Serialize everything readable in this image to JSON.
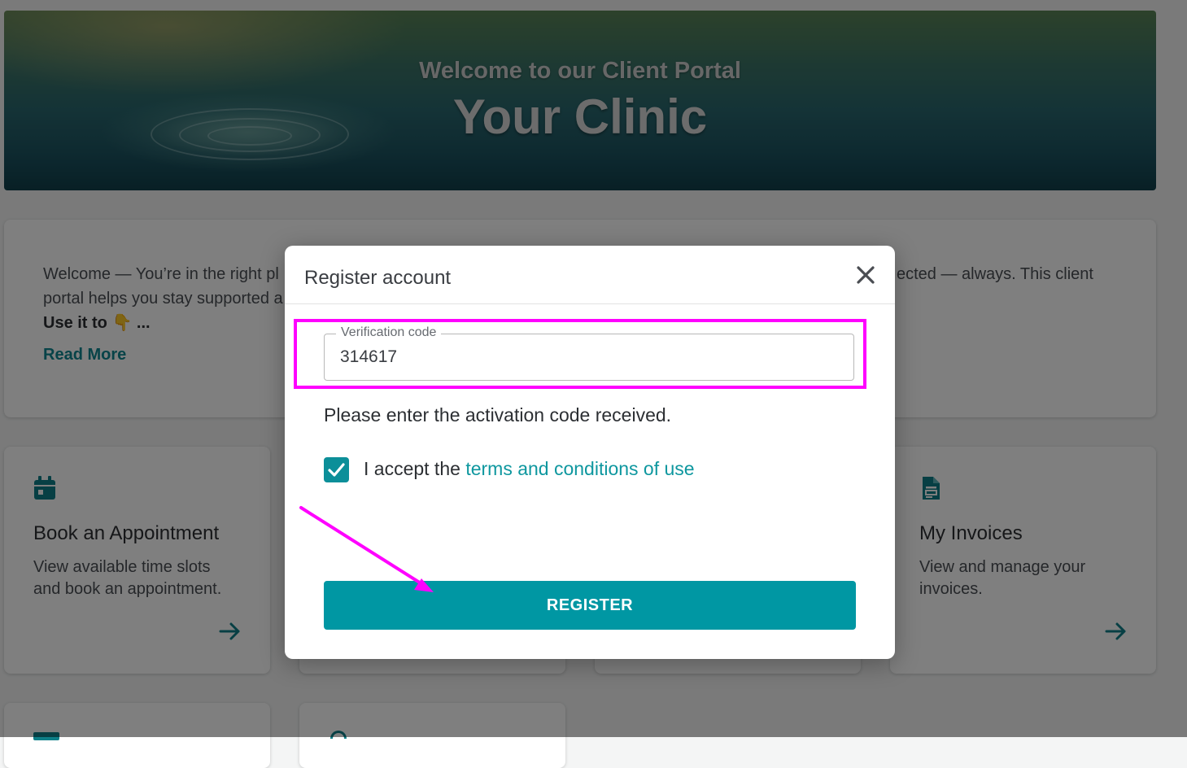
{
  "hero": {
    "subtitle": "Welcome to our Client Portal",
    "title": "Your Clinic"
  },
  "welcome_card": {
    "text_left_line1": "Welcome — You’re in the right pl",
    "text_right_line1": "ected — always. This client",
    "text_left_line2": "portal helps you stay supported a",
    "use_it_to": "Use it to 👇 ...",
    "read_more": "Read More"
  },
  "features": [
    {
      "icon": "calendar-icon",
      "title": "Book an Appointment",
      "description": "View available time slots and book an appointment."
    },
    {
      "icon": "invoice-icon",
      "title": "My Invoices",
      "description": "View and manage your invoices."
    }
  ],
  "modal": {
    "title": "Register account",
    "close_icon": "close-icon",
    "field_label": "Verification code",
    "field_value": "314617",
    "helper_text": "Please enter the activation code received.",
    "checkbox_checked": true,
    "terms_prefix": "I accept the ",
    "terms_link": "terms and conditions of use",
    "register_label": "REGISTER"
  },
  "colors": {
    "accent": "#0097a3",
    "link": "#0e979f",
    "annotation": "#ff00ff"
  }
}
